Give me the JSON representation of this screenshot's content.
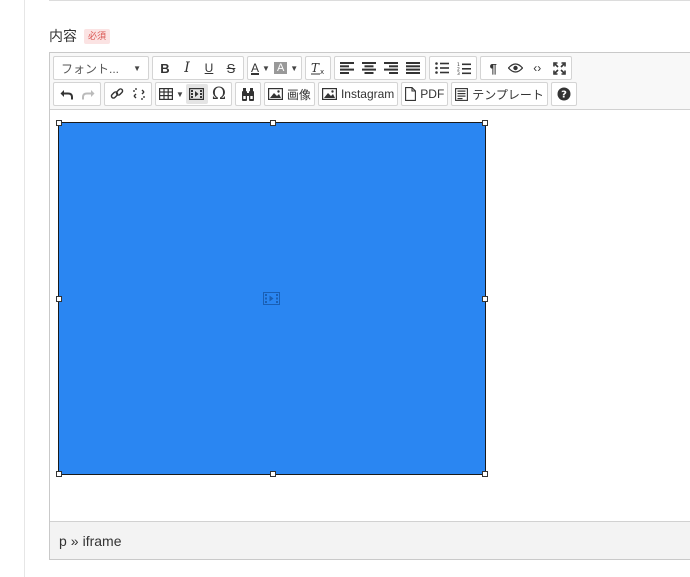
{
  "field": {
    "label": "内容",
    "required_badge": "必須"
  },
  "toolbar": {
    "font_select": "フォント...",
    "bold": "B",
    "italic": "I",
    "underline": "U",
    "strike": "S",
    "text_color": "A",
    "bg_color": "A",
    "image_label": "画像",
    "instagram_label": "Instagram",
    "pdf_label": "PDF",
    "template_label": "テンプレート"
  },
  "statusbar": {
    "path": [
      "p",
      "iframe"
    ],
    "separator": "»"
  },
  "colors": {
    "iframe_fill": "#2a86f2",
    "required_badge_text": "#d9534f"
  },
  "icons": [
    "undo-icon",
    "redo-icon",
    "link-icon",
    "unlink-icon",
    "table-icon",
    "media-icon",
    "omega-icon",
    "binoculars-icon",
    "image-icon",
    "instagram-icon",
    "pdf-file-icon",
    "template-icon",
    "help-icon",
    "align-left-icon",
    "align-center-icon",
    "align-right-icon",
    "align-justify-icon",
    "bullet-list-icon",
    "numbered-list-icon",
    "pilcrow-icon",
    "preview-eye-icon",
    "code-icon",
    "fullscreen-icon",
    "clear-format-icon"
  ]
}
